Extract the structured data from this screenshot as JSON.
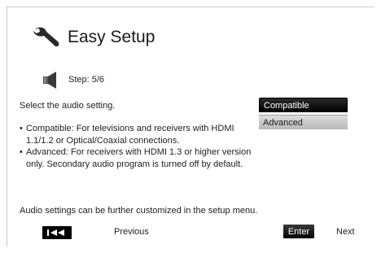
{
  "header": {
    "title": "Easy Setup",
    "icon": "wrench-icon"
  },
  "step": {
    "label": "Step: 5/6",
    "icon": "speaker-icon"
  },
  "prompt": "Select the audio setting.",
  "descriptions": [
    "Compatible: For televisions and receivers with HDMI 1.1/1.2 or Optical/Coaxial connections.",
    "Advanced: For receivers with HDMI 1.3 or higher version only. Secondary audio program is turned off by default."
  ],
  "options": [
    {
      "label": "Compatible",
      "selected": true
    },
    {
      "label": "Advanced",
      "selected": false
    }
  ],
  "footer_note": "Audio settings can be further customized in the setup menu.",
  "nav": {
    "previous_label": "Previous",
    "previous_key_icon": "skip-back-icon",
    "enter_label": "Enter",
    "next_label": "Next"
  }
}
